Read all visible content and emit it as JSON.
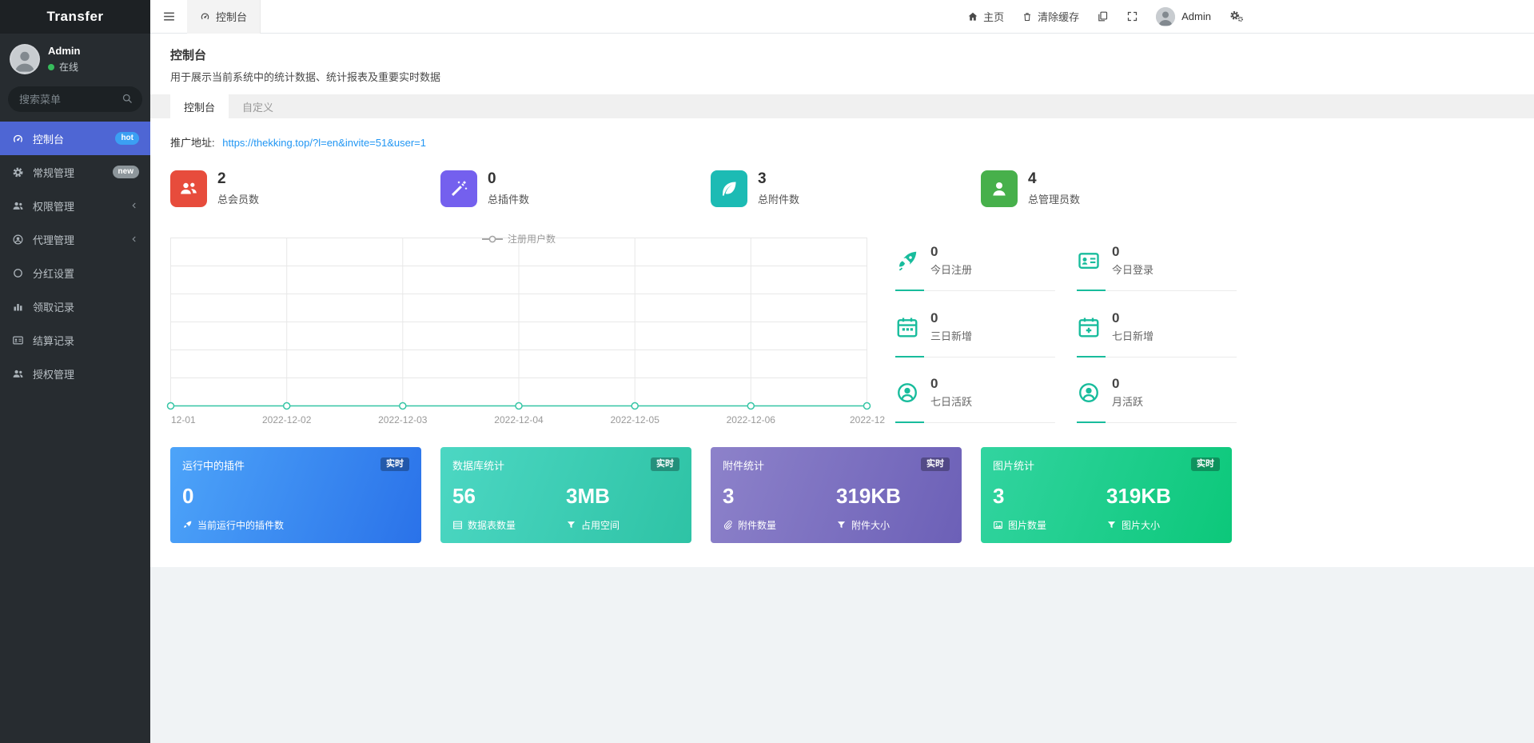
{
  "app": {
    "title": "Transfer"
  },
  "colors": {
    "sidebar_active": "#4e66d4",
    "badge_hot": "#3b9ff3",
    "badge_new": "#8d969b",
    "link": "#2196f3",
    "chart_line": "#35c5a5",
    "mini_accent": "#18bc9c",
    "stat_icon_colors": [
      "#e74c3c",
      "#7460ee",
      "#1cbbb4",
      "#47b04b"
    ],
    "card_gradients": [
      [
        "#4da4f9",
        "#2a72e9"
      ],
      [
        "#4cd7c3",
        "#2ec3a5"
      ],
      [
        "#8d82ca",
        "#6c60b7"
      ],
      [
        "#32d4a0",
        "#0cc87a"
      ]
    ]
  },
  "sidebar": {
    "user": {
      "name": "Admin",
      "status": "在线"
    },
    "search": {
      "placeholder": "搜索菜单"
    },
    "items": [
      {
        "label": "控制台",
        "badge": "hot",
        "icon": "dashboard-icon",
        "active": true
      },
      {
        "label": "常规管理",
        "badge": "new",
        "icon": "gear-icon"
      },
      {
        "label": "权限管理",
        "icon": "users-icon",
        "expandable": true
      },
      {
        "label": "代理管理",
        "icon": "agent-icon",
        "expandable": true
      },
      {
        "label": "分红设置",
        "icon": "circle-icon"
      },
      {
        "label": "领取记录",
        "icon": "bars-icon"
      },
      {
        "label": "结算记录",
        "icon": "id-card-icon"
      },
      {
        "label": "授权管理",
        "icon": "users-icon"
      }
    ]
  },
  "topbar": {
    "tab": "控制台",
    "home": "主页",
    "clear_cache": "清除缓存",
    "username": "Admin"
  },
  "page": {
    "title": "控制台",
    "subtitle": "用于展示当前系统中的统计数据、统计报表及重要实时数据",
    "tabs": [
      {
        "label": "控制台",
        "active": true
      },
      {
        "label": "自定义"
      }
    ],
    "promo": {
      "label": "推广地址:",
      "url": "https://thekking.top/?l=en&invite=51&user=1"
    },
    "stats": [
      {
        "value": "2",
        "label": "总会员数",
        "icon": "members-icon",
        "color": "#e74c3c"
      },
      {
        "value": "0",
        "label": "总插件数",
        "icon": "magic-wand-icon",
        "color": "#7460ee"
      },
      {
        "value": "3",
        "label": "总附件数",
        "icon": "leaf-icon",
        "color": "#1cbbb4"
      },
      {
        "value": "4",
        "label": "总管理员数",
        "icon": "admin-user-icon",
        "color": "#47b04b"
      }
    ],
    "mini_stats": [
      {
        "value": "0",
        "label": "今日注册",
        "icon": "rocket-icon"
      },
      {
        "value": "0",
        "label": "今日登录",
        "icon": "id-card-icon"
      },
      {
        "value": "0",
        "label": "三日新增",
        "icon": "calendar-icon"
      },
      {
        "value": "0",
        "label": "七日新增",
        "icon": "calendar-plus-icon"
      },
      {
        "value": "0",
        "label": "七日活跃",
        "icon": "user-circle-icon"
      },
      {
        "value": "0",
        "label": "月活跃",
        "icon": "user-circle-icon"
      }
    ],
    "cards": [
      {
        "title": "运行中的插件",
        "badge": "实时",
        "value": "0",
        "desc": "当前运行中的插件数",
        "icon": "rocket-icon"
      },
      {
        "title": "数据库统计",
        "badge": "实时",
        "value": "56",
        "desc": "数据表数量",
        "icon": "table-icon",
        "value2": "3MB",
        "desc2": "占用空间",
        "icon2": "funnel-icon"
      },
      {
        "title": "附件统计",
        "badge": "实时",
        "value": "3",
        "desc": "附件数量",
        "icon": "paperclip-icon",
        "value2": "319KB",
        "desc2": "附件大小",
        "icon2": "funnel-icon"
      },
      {
        "title": "图片统计",
        "badge": "实时",
        "value": "3",
        "desc": "图片数量",
        "icon": "image-icon",
        "value2": "319KB",
        "desc2": "图片大小",
        "icon2": "funnel-icon"
      }
    ]
  },
  "chart_data": {
    "type": "line",
    "title": "",
    "legend": [
      "注册用户数"
    ],
    "legend_position": "top-center",
    "x": [
      "12-01",
      "2022-12-02",
      "2022-12-03",
      "2022-12-04",
      "2022-12-05",
      "2022-12-06",
      "2022-12"
    ],
    "series": [
      {
        "name": "注册用户数",
        "values": [
          0,
          0,
          0,
          0,
          0,
          0,
          0
        ]
      }
    ],
    "ylim": [
      0,
      1
    ],
    "grid": true,
    "marker": "hollow-circle"
  }
}
